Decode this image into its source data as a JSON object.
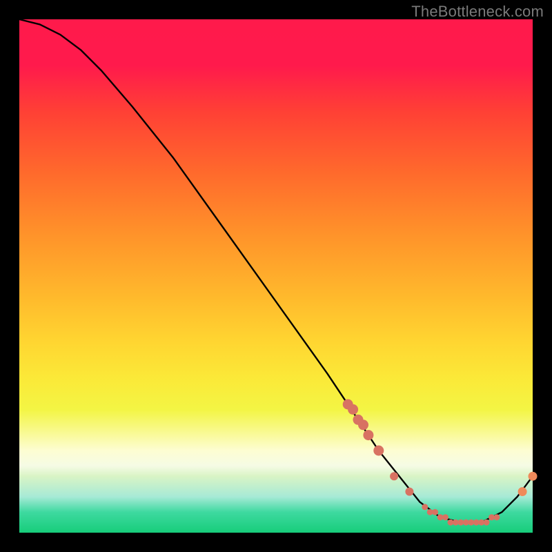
{
  "watermark": "TheBottleneck.com",
  "chart_data": {
    "type": "line",
    "title": "",
    "xlabel": "",
    "ylabel": "",
    "xlim": [
      0,
      100
    ],
    "ylim": [
      0,
      100
    ],
    "grid": false,
    "legend": false,
    "background": "rainbow-gradient-vertical",
    "series": [
      {
        "name": "bottleneck-curve",
        "color": "#000000",
        "x": [
          0,
          4,
          8,
          12,
          16,
          22,
          30,
          40,
          50,
          60,
          66,
          70,
          74,
          78,
          82,
          86,
          90,
          94,
          97,
          100
        ],
        "y": [
          100,
          99,
          97,
          94,
          90,
          83,
          73,
          59,
          45,
          31,
          22,
          16,
          11,
          6,
          3,
          2,
          2,
          4,
          7,
          11
        ]
      }
    ],
    "markers": {
      "name": "highlight-points",
      "color": "#d87262",
      "x": [
        64,
        65,
        66,
        67,
        68,
        70,
        73,
        76,
        79,
        80,
        81,
        82,
        83,
        84,
        85,
        86,
        87,
        88,
        89,
        90,
        91,
        92,
        93,
        98,
        100
      ],
      "y": [
        25,
        24,
        22,
        21,
        19,
        16,
        11,
        8,
        5,
        4,
        4,
        3,
        3,
        2,
        2,
        2,
        2,
        2,
        2,
        2,
        2,
        3,
        3,
        8,
        11
      ]
    }
  }
}
